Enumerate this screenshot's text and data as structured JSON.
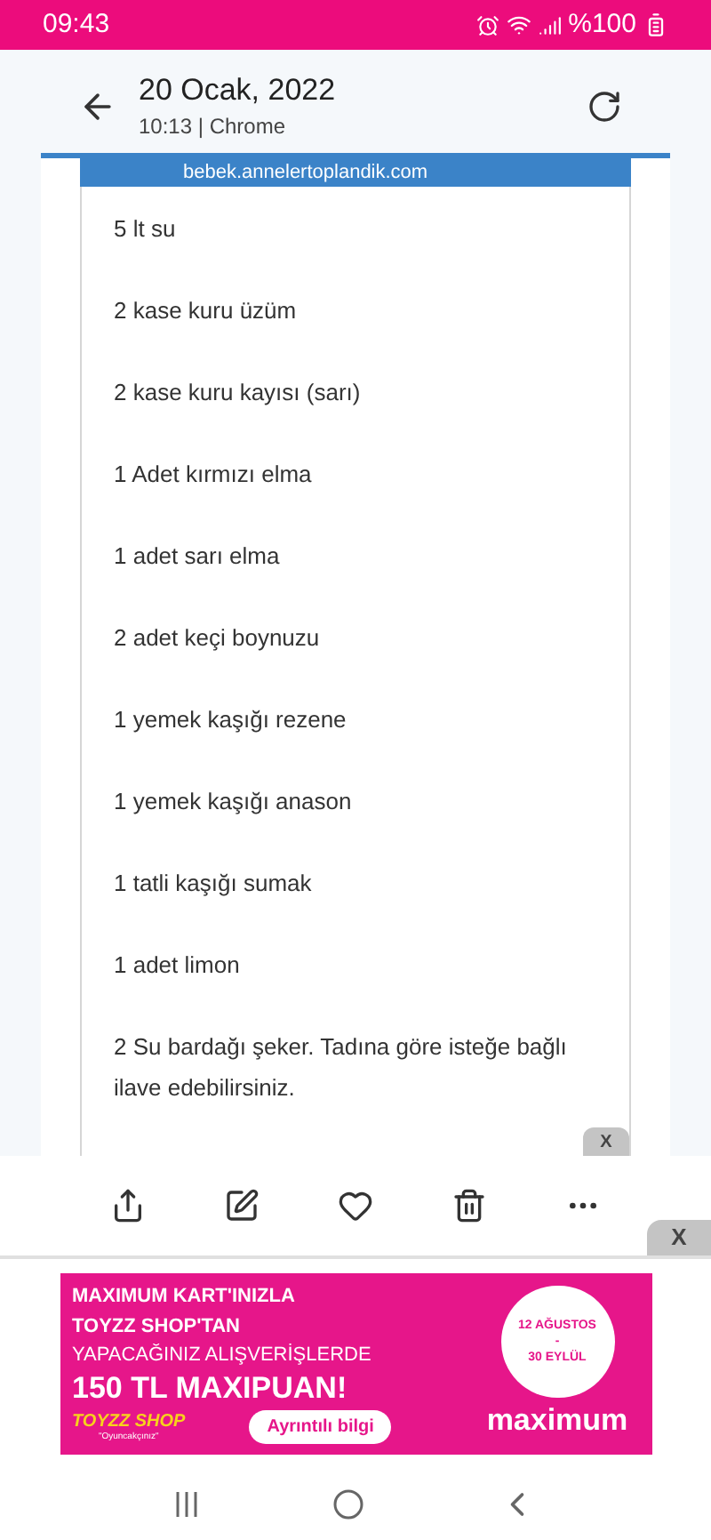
{
  "status_bar": {
    "time": "09:43",
    "battery": "%100"
  },
  "header": {
    "title": "20 Ocak, 2022",
    "subtitle": "10:13 | Chrome"
  },
  "document": {
    "url": "bebek.annelertoplandik.com",
    "items": [
      "5 lt su",
      "2  kase kuru üzüm",
      "2  kase kuru kayısı (sarı)",
      "1 Adet kırmızı elma",
      "1 adet sarı elma",
      "2 adet keçi boynuzu",
      "1 yemek kaşığı rezene",
      "1 yemek kaşığı anason",
      "1 tatli kaşığı sumak",
      "1 adet limon",
      "2 Su bardağı şeker.  Tadına göre isteğe bağlı ilave edebilirsiniz."
    ],
    "close": "X"
  },
  "toolbar": [
    {
      "kind": "share"
    },
    {
      "kind": "edit"
    },
    {
      "kind": "favorite"
    },
    {
      "kind": "delete"
    },
    {
      "kind": "more"
    }
  ],
  "ad": {
    "close": "X",
    "line1": "MAXIMUM KART'INIZLA",
    "line2": "TOYZZ SHOP'TAN",
    "line3": "YAPACAĞINIZ ALIŞVERİŞLERDE",
    "line4": "150 TL MAXIPUAN!",
    "date1": "12 AĞUSTOS",
    "date_sep": "-",
    "date2": "30 EYLÜL",
    "logo1": "TOYZZ SHOP",
    "logo1_tagline": "\"Oyuncakçınız\"",
    "button": "Ayrıntılı bilgi",
    "logo2": "maximum"
  }
}
